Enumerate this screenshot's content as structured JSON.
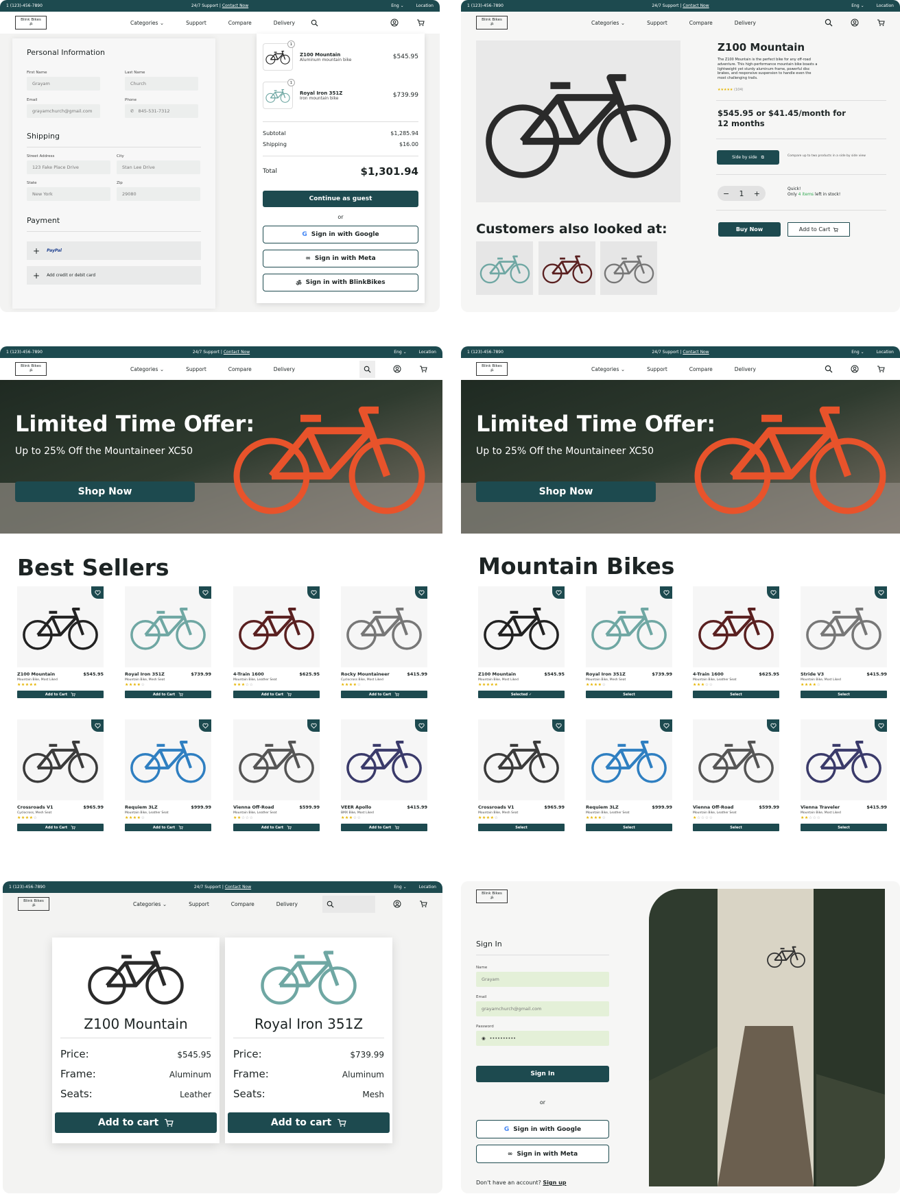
{
  "common": {
    "phone": "1 (123)-456-7890",
    "support": "24/7 Support",
    "contact": "Contact Now",
    "lang": "Eng",
    "location": "Location",
    "logo": "Blink Bikes",
    "nav": [
      "Categories",
      "Support",
      "Compare",
      "Delivery"
    ]
  },
  "checkout": {
    "personal_title": "Personal Information",
    "first_name_label": "First Name",
    "first_name": "Grayam",
    "last_name_label": "Last Name",
    "last_name": "Church",
    "email_label": "Email",
    "email": "grayamchurch@gmail.com",
    "phone_label": "Phone",
    "phone": "845-531-7312",
    "shipping_title": "Shipping",
    "street_label": "Street Address",
    "street": "123 Fake Place Drive",
    "city_label": "City",
    "city": "Stan Lee Drive",
    "state_label": "State",
    "state": "New York",
    "zip_label": "Zip",
    "zip": "29080",
    "payment_title": "Payment",
    "paypal": "PayPal",
    "add_card": "Add credit or debit card",
    "items": [
      {
        "name": "Z100 Mountain",
        "desc": "Aluminum mountain bike",
        "price": "$545.95",
        "qty": "1"
      },
      {
        "name": "Royal Iron 351Z",
        "desc": "Iron mountain bike",
        "price": "$739.99",
        "qty": "1"
      }
    ],
    "subtotal_label": "Subtotal",
    "subtotal": "$1,285.94",
    "shipping_label": "Shipping",
    "shipping": "$16.00",
    "total_label": "Total",
    "total": "$1,301.94",
    "guest_btn": "Continue as guest",
    "or": "or",
    "google_btn": "Sign in with Google",
    "meta_btn": "Sign in with Meta",
    "blink_btn": "Sign in with BlinkBikes"
  },
  "product": {
    "title": "Z100 Mountain",
    "desc": "The Z100 Mountain is the perfect bike for any off-road adventure. This high-performance mountain bike boasts a lightweight yet sturdy aluminum frame, powerful disc brakes, and responsive suspension to handle even the most challenging trails.",
    "stars": "★★★★★",
    "reviews": "(104)",
    "price": "$545.95 or $41.45/month for 12 months",
    "side_btn": "Side by side",
    "side_note": "Compare up to two products in a side by side view",
    "qty": "1",
    "stock_1": "Quick!",
    "stock_2a": "Only ",
    "stock_2b": "4 items",
    "stock_2c": " left in stock!",
    "buy_btn": "Buy Now",
    "cart_btn": "Add to Cart",
    "also_title": "Customers also looked at:"
  },
  "hero": {
    "title": "Limited Time Offer:",
    "subtitle": "Up to 25% Off the Mountaineer XC50",
    "cta": "Shop Now"
  },
  "best_sellers": {
    "title": "Best Sellers",
    "add_label": "Add to Cart",
    "items": [
      {
        "name": "Z100 Mountain",
        "price": "$545.95",
        "sub": "Mountain Bike, Most Liked",
        "stars": "★★★★★",
        "empty": ""
      },
      {
        "name": "Royal Iron 351Z",
        "price": "$739.99",
        "sub": "Mountain Bike, Mesh Seat",
        "stars": "★★★★",
        "empty": "☆"
      },
      {
        "name": "4-Train 1600",
        "price": "$625.95",
        "sub": "Mountain Bike, Leather Seat",
        "stars": "★★★",
        "empty": "☆☆"
      },
      {
        "name": "Rocky Mountaineer",
        "price": "$415.99",
        "sub": "Cyclocross Bike, Most Liked",
        "stars": "★★★★",
        "empty": "☆"
      },
      {
        "name": "Crossroads V1",
        "price": "$965.99",
        "sub": "Cyclocross, Mesh Seat",
        "stars": "★★★★",
        "empty": "☆"
      },
      {
        "name": "Requiem 3LZ",
        "price": "$999.99",
        "sub": "Mountain Bike, Leather Seat",
        "stars": "★★★★",
        "empty": "☆"
      },
      {
        "name": "Vienna Off-Road",
        "price": "$599.99",
        "sub": "Mountain Bike, Leather Seat",
        "stars": "★★",
        "empty": "☆☆☆"
      },
      {
        "name": "VEER Apollo",
        "price": "$415.99",
        "sub": "BMX Bike, Most Liked",
        "stars": "★★★",
        "empty": "☆☆"
      }
    ]
  },
  "mountain": {
    "title": "Mountain Bikes",
    "items": [
      {
        "name": "Z100 Mountain",
        "price": "$545.95",
        "sub": "Mountain Bike, Most Liked",
        "stars": "★★★★★",
        "empty": "",
        "btn": "Selected ✓"
      },
      {
        "name": "Royal Iron 351Z",
        "price": "$739.99",
        "sub": "Mountain Bike, Mesh Seat",
        "stars": "★★★★",
        "empty": "☆",
        "btn": "Select"
      },
      {
        "name": "4-Train 1600",
        "price": "$625.95",
        "sub": "Mountain Bike, Leather Seat",
        "stars": "★★★",
        "empty": "☆☆",
        "btn": "Select"
      },
      {
        "name": "Stride V3",
        "price": "$415.99",
        "sub": "Mountain Bike, Most Liked",
        "stars": "★★★★",
        "empty": "☆",
        "btn": "Select"
      },
      {
        "name": "Crossroads V1",
        "price": "$965.99",
        "sub": "Mountain Bike, Mesh Seat",
        "stars": "★★★★",
        "empty": "☆",
        "btn": "Select"
      },
      {
        "name": "Requiem 3LZ",
        "price": "$999.99",
        "sub": "Mountain Bike, Leather Seat",
        "stars": "★★★★",
        "empty": "☆",
        "btn": "Select"
      },
      {
        "name": "Vienna Off-Road",
        "price": "$599.99",
        "sub": "Mountain Bike, Leather Seat",
        "stars": "★",
        "empty": "☆☆☆☆",
        "btn": "Select"
      },
      {
        "name": "Vienna Traveler",
        "price": "$415.99",
        "sub": "Mountain Bike, Most Liked",
        "stars": "★★",
        "empty": "☆☆☆",
        "btn": "Select"
      }
    ]
  },
  "compare": {
    "price_label": "Price:",
    "frame_label": "Frame:",
    "seats_label": "Seats:",
    "add_label": "Add to cart",
    "items": [
      {
        "name": "Z100 Mountain",
        "price": "$545.95",
        "frame": "Aluminum",
        "seats": "Leather"
      },
      {
        "name": "Royal Iron 351Z",
        "price": "$739.99",
        "frame": "Aluminum",
        "seats": "Mesh"
      }
    ]
  },
  "signin": {
    "title": "Sign In",
    "name_label": "Name",
    "name": "Grayam",
    "email_label": "Email",
    "email": "grayamchurch@gmail.com",
    "password_label": "Password",
    "password": "••••••••••",
    "btn": "Sign In",
    "or": "or",
    "google": "Sign in with Google",
    "meta": "Sign in with Meta",
    "no_account": "Don't have an account?",
    "signup": "Sign up"
  },
  "colors": {
    "primary": "#1d4a4f",
    "star": "#e5b400",
    "accent_green": "#2fa84f",
    "field_green": "#e4f0d8"
  }
}
